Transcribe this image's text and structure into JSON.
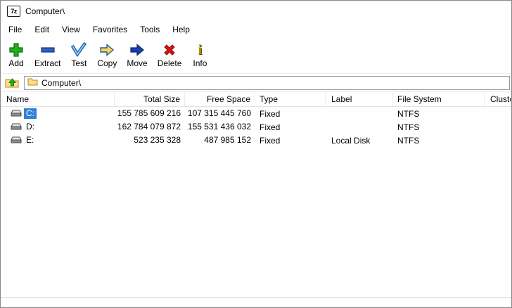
{
  "window": {
    "title": "Computer\\",
    "app_icon_label": "7z"
  },
  "menu": {
    "file": "File",
    "edit": "Edit",
    "view": "View",
    "favorites": "Favorites",
    "tools": "Tools",
    "help": "Help"
  },
  "toolbar": {
    "add": "Add",
    "extract": "Extract",
    "test": "Test",
    "copy": "Copy",
    "move": "Move",
    "delete": "Delete",
    "info": "Info",
    "info_glyph": "i"
  },
  "addressbar": {
    "path": "Computer\\"
  },
  "table": {
    "columns": {
      "name": "Name",
      "total_size": "Total Size",
      "free_space": "Free Space",
      "type": "Type",
      "label": "Label",
      "file_system": "File System",
      "cluster": "Cluste"
    },
    "rows": [
      {
        "name": "C:",
        "total_size": "155 785 609 216",
        "free_space": "107 315 445 760",
        "type": "Fixed",
        "label": "",
        "file_system": "NTFS",
        "cluster": "",
        "selected": true
      },
      {
        "name": "D:",
        "total_size": "162 784 079 872",
        "free_space": "155 531 436 032",
        "type": "Fixed",
        "label": "",
        "file_system": "NTFS",
        "cluster": "",
        "selected": false
      },
      {
        "name": "E:",
        "total_size": "523 235 328",
        "free_space": "487 985 152",
        "type": "Fixed",
        "label": "Local Disk",
        "file_system": "NTFS",
        "cluster": "",
        "selected": false
      }
    ]
  },
  "icons": {
    "add-icon": "green-plus",
    "extract-icon": "blue-minus",
    "test-icon": "blue-checkmark",
    "copy-icon": "yellow-right-arrow",
    "move-icon": "blue-right-arrow",
    "delete-icon": "red-x",
    "info-icon": "serif-i",
    "up-one-level-icon": "folder-with-green-up-arrow",
    "folder-icon": "yellow-folder",
    "drive-icon": "hard-drive"
  },
  "colors": {
    "selection": "#2f80d9",
    "add_green": "#1faf1f",
    "extract_blue": "#2a62c8",
    "delete_red": "#dd1111",
    "folder_yellow": "#ffdf80"
  }
}
